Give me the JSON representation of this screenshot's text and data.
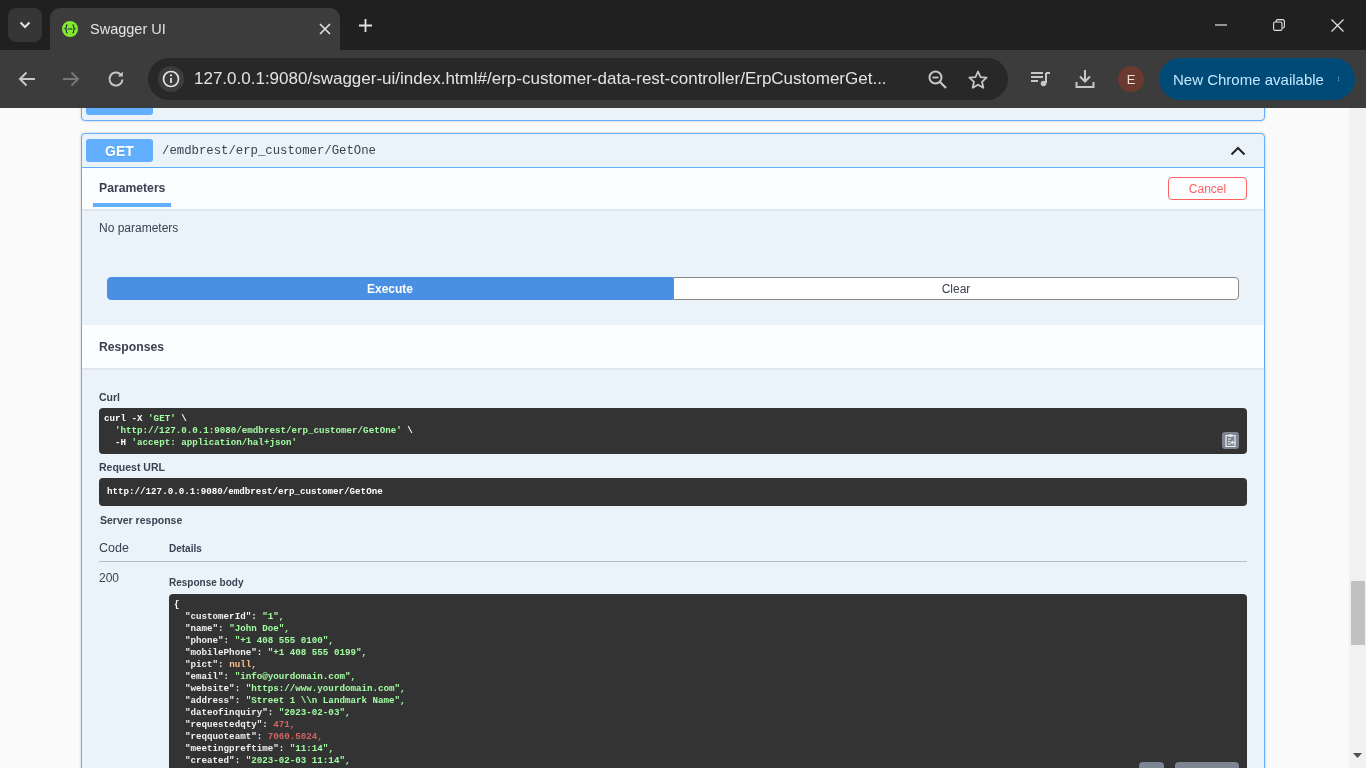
{
  "browser": {
    "tabs": [
      {
        "title": "Swagger UI",
        "selected": true
      }
    ],
    "address": "127.0.0.1:9080/swagger-ui/index.html#/erp-customer-data-rest-controller/ErpCustomerGet...",
    "profile_initial": "E",
    "update_button": "New Chrome available"
  },
  "operations": [
    {
      "expanded": false
    },
    {
      "method": "GET",
      "path": "/emdbrest/erp_customer/GetOne",
      "expanded": true,
      "tabs": [
        {
          "label": "Parameters",
          "selected": true
        }
      ],
      "cancel_button": "Cancel",
      "parameters_note": "No parameters",
      "execute_button": "Execute",
      "clear_button": "Clear",
      "responses_title": "Responses",
      "curl_label": "Curl",
      "curl": {
        "command": [
          {
            "text": "curl -X ",
            "kind": "plain"
          },
          {
            "text": "'GET'",
            "kind": "string"
          },
          {
            "text": " \\",
            "kind": "plain"
          }
        ],
        "args": [
          [
            {
              "text": "'http://127.0.0.1:9080/emdbrest/erp_customer/GetOne'",
              "kind": "string"
            },
            {
              "text": " \\",
              "kind": "plain"
            }
          ],
          [
            {
              "text": "-H ",
              "kind": "plain"
            },
            {
              "text": "'accept: application/hal+json'",
              "kind": "string"
            }
          ]
        ]
      },
      "request_url_label": "Request URL",
      "request_url": "http://127.0.0.1:9080/emdbrest/erp_customer/GetOne",
      "server_response_label": "Server response",
      "columns": [
        "Code",
        "Details"
      ],
      "rows": [
        {
          "code": "200",
          "body_label": "Response body",
          "body": {
            "open": "{",
            "fields": [
              {
                "key": "\"customerId\": ",
                "value": "\"1\",",
                "kind": "string"
              },
              {
                "key": "\"name\": ",
                "value": "\"John Doe\",",
                "kind": "string"
              },
              {
                "key": "\"phone\": ",
                "value": "\"+1 408 555 0100\",",
                "kind": "string"
              },
              {
                "key": "\"mobilePhone\": ",
                "value": "\"+1 408 555 0199\",",
                "kind": "string"
              },
              {
                "key": "\"pict\": ",
                "value": "null,",
                "kind": "null"
              },
              {
                "key": "\"email\": ",
                "value": "\"info@yourdomain.com\",",
                "kind": "string"
              },
              {
                "key": "\"website\": ",
                "value": "\"https://www.yourdomain.com\",",
                "kind": "string"
              },
              {
                "key": "\"address\": ",
                "value": "\"Street 1 \\\\n Landmark Name\",",
                "kind": "string"
              },
              {
                "key": "\"dateofinquiry\": ",
                "value": "\"2023-02-03\",",
                "kind": "string"
              },
              {
                "key": "\"requestedqty\": ",
                "value": "471,",
                "kind": "number"
              },
              {
                "key": "\"reqquoteamt\": ",
                "value": "7060.5024,",
                "kind": "number"
              },
              {
                "key": "\"meetingpreftime\": ",
                "value": "\"11:14\",",
                "kind": "string"
              },
              {
                "key": "\"created\": ",
                "value": "\"2023-02-03 11:14\",",
                "kind": "string"
              }
            ]
          }
        }
      ]
    }
  ]
}
